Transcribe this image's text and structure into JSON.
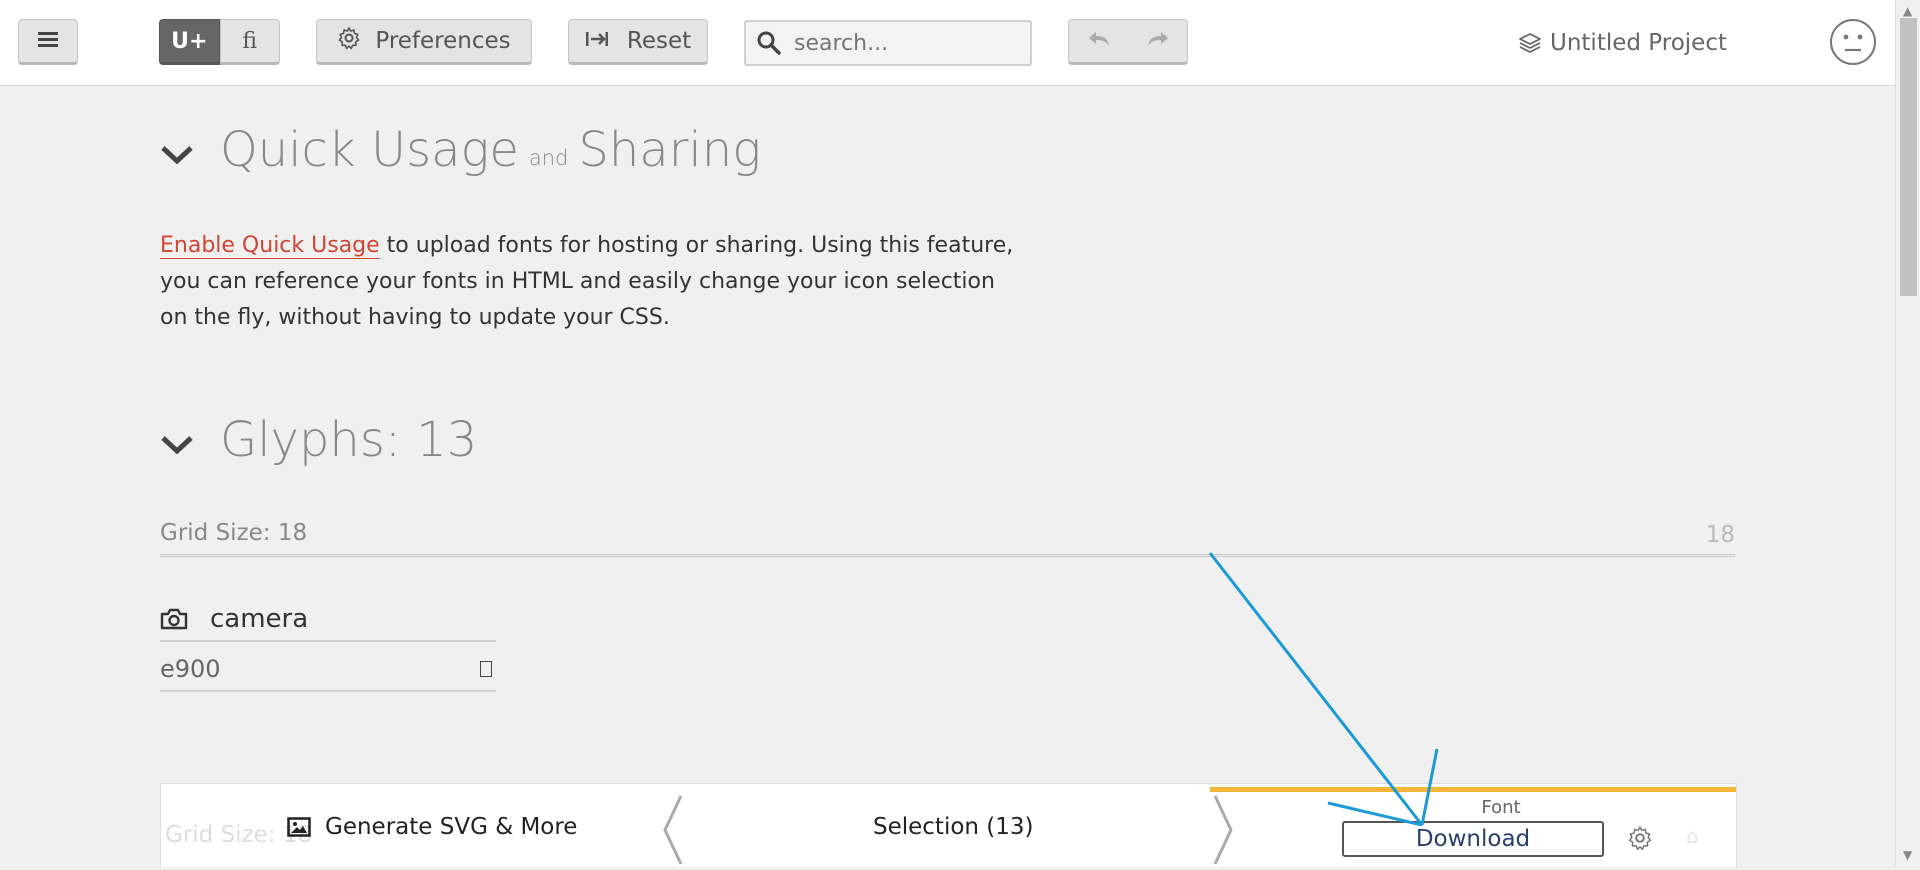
{
  "toolbar": {
    "segment_unicode": "U+",
    "segment_ligature": "ﬁ",
    "preferences_label": "Preferences",
    "reset_label": "Reset",
    "search_placeholder": "search...",
    "project_name": "Untitled Project"
  },
  "quick_usage": {
    "heading_part1": "Quick Usage",
    "heading_and": "and",
    "heading_part2": "Sharing",
    "link_text": "Enable Quick Usage",
    "desc_line1_rest": " to upload fonts for hosting or sharing. Using this feature,",
    "desc_line2": "you can reference your fonts in HTML and easily change your icon selection",
    "desc_line3": "on the fly, without having to update your CSS."
  },
  "glyphs": {
    "heading": "Glyphs: 13",
    "grid_size_label": "Grid Size: 18",
    "grid_size_value": "18",
    "items": [
      {
        "name": "camera",
        "code": "e900"
      }
    ]
  },
  "bottom_bar": {
    "ghost_text": "Grid Size: 18",
    "generate_label": "Generate SVG & More",
    "selection_label": "Selection (13)",
    "font_label": "Font",
    "download_label": "Download"
  },
  "icons": [
    "menu-icon",
    "gear-icon",
    "reset-icon",
    "search-icon",
    "undo-icon",
    "redo-icon",
    "layers-icon",
    "avatar-icon",
    "chevron-down-icon",
    "camera-icon",
    "image-icon",
    "chevron-left-icon",
    "chevron-right-icon"
  ],
  "colors": {
    "accent_link": "#d24433",
    "font_tab": "#f6b63a",
    "annotation_arrow": "#1a9ad6",
    "download_text": "#2a3e70"
  }
}
